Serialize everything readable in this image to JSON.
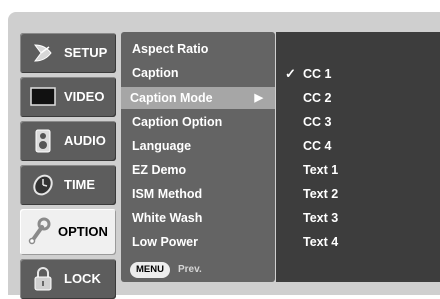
{
  "sidebar": {
    "items": [
      {
        "label": "SETUP",
        "icon": "satellite-dish-icon"
      },
      {
        "label": "VIDEO",
        "icon": "monitor-icon"
      },
      {
        "label": "AUDIO",
        "icon": "speaker-icon"
      },
      {
        "label": "TIME",
        "icon": "clock-icon"
      },
      {
        "label": "OPTION",
        "icon": "wrench-icon",
        "active": true
      },
      {
        "label": "LOCK",
        "icon": "padlock-icon"
      }
    ]
  },
  "menu": {
    "items": [
      {
        "label": "Aspect Ratio"
      },
      {
        "label": "Caption"
      },
      {
        "label": "Caption Mode",
        "selected": true,
        "arrow": "▶"
      },
      {
        "label": "Caption Option"
      },
      {
        "label": "Language"
      },
      {
        "label": "EZ Demo"
      },
      {
        "label": "ISM Method"
      },
      {
        "label": "White Wash"
      },
      {
        "label": "Low Power"
      }
    ],
    "footer": {
      "button": "MENU",
      "hint": "Prev."
    }
  },
  "options": {
    "check_mark": "✓",
    "items": [
      "CC 1",
      "CC 2",
      "CC 3",
      "CC 4",
      "Text 1",
      "Text 2",
      "Text 3",
      "Text 4"
    ],
    "checked_index": 0
  }
}
